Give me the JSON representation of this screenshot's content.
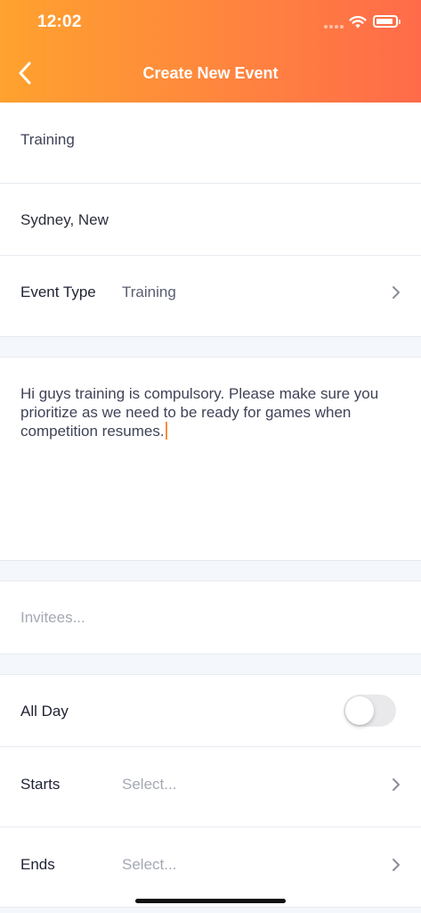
{
  "status_bar": {
    "time": "12:02"
  },
  "header": {
    "title": "Create New Event",
    "back_icon": "chevron-left-icon"
  },
  "form": {
    "title_value": "Training",
    "location_value": "Sydney, New",
    "event_type": {
      "label": "Event Type",
      "value": "Training"
    },
    "notes_value": "Hi guys training is compulsory. Please make sure you prioritize as we need to be ready for games when competition resumes.",
    "invitees_placeholder": "Invitees...",
    "all_day": {
      "label": "All Day",
      "enabled": false
    },
    "starts": {
      "label": "Starts",
      "placeholder": "Select..."
    },
    "ends": {
      "label": "Ends",
      "placeholder": "Select..."
    }
  },
  "colors": {
    "header_gradient_start": "#ffa22e",
    "header_gradient_end": "#ff6b4a",
    "caret": "#ff8a3c",
    "section_gap": "#f4f7fb"
  }
}
